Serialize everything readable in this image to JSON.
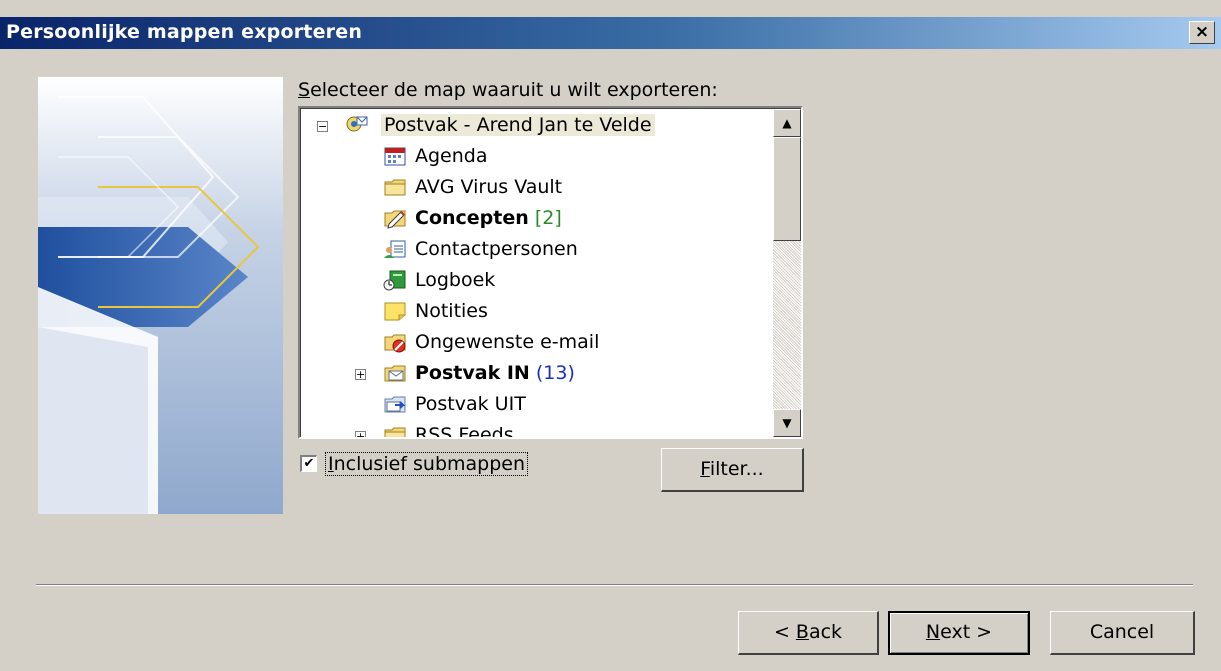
{
  "window": {
    "title": "Persoonlijke mappen exporteren",
    "close_glyph": "×"
  },
  "prompt": {
    "mnemonic": "S",
    "rest": "electeer de map waaruit u wilt exporteren:"
  },
  "tree": {
    "root": {
      "label": "Postvak - Arend Jan te Velde",
      "expander": "−",
      "icon": "mailbox-icon"
    },
    "items": [
      {
        "label": "Agenda",
        "icon": "calendar-icon"
      },
      {
        "label": "AVG Virus Vault",
        "icon": "folder-icon"
      },
      {
        "label": "Concepten",
        "count": "[2]",
        "icon": "drafts-icon"
      },
      {
        "label": "Contactpersonen",
        "icon": "contacts-icon"
      },
      {
        "label": "Logboek",
        "icon": "journal-icon"
      },
      {
        "label": "Notities",
        "icon": "notes-icon"
      },
      {
        "label": "Ongewenste e-mail",
        "icon": "junk-mail-icon"
      },
      {
        "label": "Postvak IN",
        "count": "(13)",
        "icon": "inbox-icon",
        "expander": "+"
      },
      {
        "label": "Postvak UIT",
        "icon": "outbox-icon"
      },
      {
        "label": "RSS Feeds",
        "icon": "folder-icon",
        "expander": "+"
      }
    ]
  },
  "include_subfolders": {
    "checked": true,
    "check_glyph": "✔",
    "mnemonic": "I",
    "rest": "nclusief submappen"
  },
  "buttons": {
    "filter": {
      "mnemonic": "F",
      "rest": "ilter..."
    },
    "back": {
      "prefix": "< ",
      "mnemonic": "B",
      "rest": "ack"
    },
    "next": {
      "mnemonic": "N",
      "rest": "ext >"
    },
    "cancel": {
      "label": "Cancel"
    }
  },
  "scrollbar": {
    "up_glyph": "▲",
    "down_glyph": "▼"
  },
  "colors": {
    "title_bar_start": "#0a246a",
    "title_bar_end": "#a6caf0",
    "dialog_face": "#d4d0c8",
    "count_green": "#2a8a2a",
    "count_blue": "#1a2fbf"
  }
}
